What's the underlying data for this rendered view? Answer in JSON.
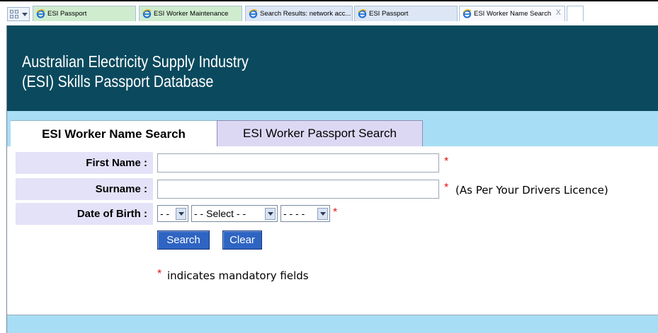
{
  "browser": {
    "tabs": [
      {
        "label": "ESI Passport",
        "active": false
      },
      {
        "label": "ESI Worker Maintenance",
        "active": false
      },
      {
        "label": "Search Results: network acc...",
        "active": false
      },
      {
        "label": "ESI Passport",
        "active": false
      },
      {
        "label": "ESI Worker Name Search",
        "active": true
      }
    ],
    "close_label": "X"
  },
  "header": {
    "line1": "Australian Electricity Supply Industry",
    "line2": "(ESI) Skills Passport Database"
  },
  "page_tabs": {
    "name_search": "ESI Worker Name Search",
    "passport_search": "ESI Worker Passport Search"
  },
  "form": {
    "first_name_label": "First Name :",
    "first_name_value": "",
    "surname_label": "Surname :",
    "surname_value": "",
    "surname_note": "(As Per Your Drivers Licence)",
    "dob_label": "Date of Birth :",
    "dob_day": "- -",
    "dob_month": "- - Select - -",
    "dob_year": "- - - -",
    "required_marker": "*",
    "search_button": "Search",
    "clear_button": "Clear",
    "mandatory_note": "indicates mandatory fields"
  },
  "colors": {
    "header_bg": "#0b4a5e",
    "band_bg": "#a8def5",
    "label_bg": "#e3e2f8",
    "button_bg": "#2e64c2",
    "required": "#e01414"
  }
}
